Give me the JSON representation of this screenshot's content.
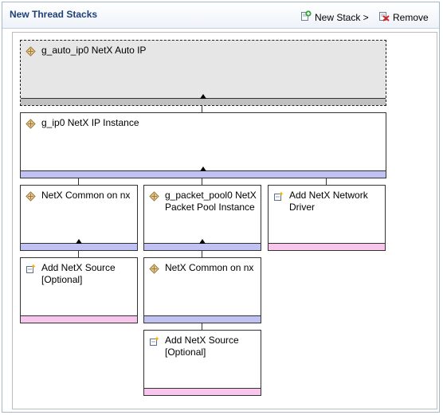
{
  "header": {
    "title": "New Thread Stacks",
    "new_stack_label": "New Stack >",
    "remove_label": "Remove"
  },
  "colors": {
    "title": "#1e3f78",
    "bar_gray": "#c0c0c0",
    "bar_blue": "#c0c2f3",
    "bar_pink": "#f8c6ec"
  },
  "stack": {
    "nodes": [
      {
        "key": "auto_ip",
        "label": "g_auto_ip0 NetX Auto IP",
        "icon": "module-icon",
        "bar": "gray",
        "selected": true
      },
      {
        "key": "ip",
        "label": "g_ip0 NetX IP Instance",
        "icon": "module-icon",
        "bar": "blue"
      },
      {
        "key": "common1",
        "label": "NetX Common on nx",
        "icon": "module-icon",
        "bar": "blue"
      },
      {
        "key": "pool",
        "label": "g_packet_pool0 NetX Packet Pool Instance",
        "icon": "module-icon",
        "bar": "blue"
      },
      {
        "key": "driver",
        "label": "Add NetX Network Driver",
        "icon": "add-module-icon",
        "bar": "pink"
      },
      {
        "key": "source1",
        "label": "Add NetX Source [Optional]",
        "icon": "add-module-icon",
        "bar": "pink"
      },
      {
        "key": "common2",
        "label": "NetX Common on nx",
        "icon": "module-icon",
        "bar": "blue"
      },
      {
        "key": "source2",
        "label": "Add NetX Source [Optional]",
        "icon": "add-module-icon",
        "bar": "pink"
      }
    ]
  }
}
